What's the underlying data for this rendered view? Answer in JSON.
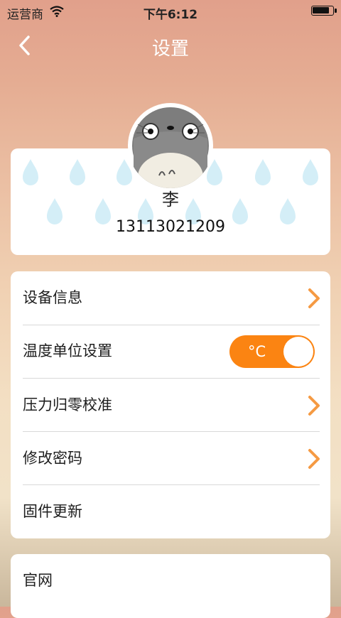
{
  "status_bar": {
    "carrier": "运营商",
    "time": "下午6:12",
    "battery_level": 0.9
  },
  "nav": {
    "title": "设置",
    "back_icon": "chevron-left-icon"
  },
  "profile": {
    "name": "李",
    "phone": "13113021209",
    "avatar_icon": "totoro-avatar"
  },
  "settings": {
    "items": [
      {
        "label": "设备信息",
        "accessory": "chevron-right-icon"
      },
      {
        "label": "温度单位设置",
        "accessory": "toggle"
      },
      {
        "label": "压力归零校准",
        "accessory": "chevron-right-icon"
      },
      {
        "label": "修改密码",
        "accessory": "chevron-right-icon"
      },
      {
        "label": "固件更新",
        "accessory": "none"
      }
    ],
    "temperature_unit": "°C",
    "temperature_toggle_on": true
  },
  "links": {
    "items": [
      {
        "label": "官网"
      }
    ]
  },
  "colors": {
    "accent": "#fb8412",
    "chevron": "#f59a43",
    "drop": "#d4eef7"
  }
}
